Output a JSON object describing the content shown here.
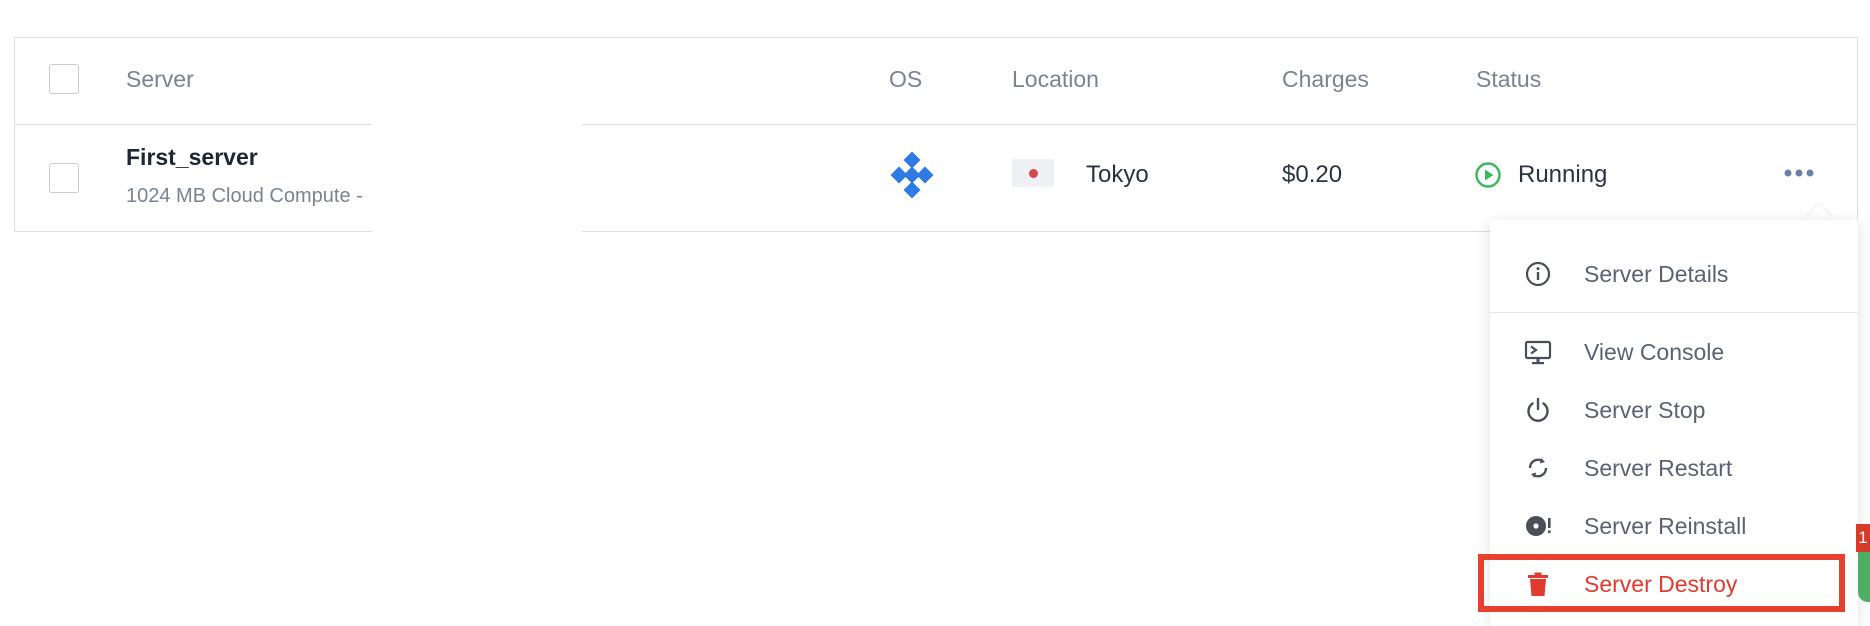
{
  "table": {
    "headers": {
      "server": "Server",
      "os": "OS",
      "location": "Location",
      "charges": "Charges",
      "status": "Status"
    },
    "rows": [
      {
        "name": "First_server",
        "plan": "1024 MB Cloud Compute -",
        "os_icon": "os-logo-icon",
        "location_flag": "japan-flag-icon",
        "location": "Tokyo",
        "charges": "$0.20",
        "status": "Running",
        "status_color": "#3cb85c"
      }
    ]
  },
  "menu": {
    "items": [
      {
        "label": "Server Details",
        "icon": "info-icon"
      },
      {
        "label": "View Console",
        "icon": "console-icon"
      },
      {
        "label": "Server Stop",
        "icon": "power-icon"
      },
      {
        "label": "Server Restart",
        "icon": "restart-icon"
      },
      {
        "label": "Server Reinstall",
        "icon": "reinstall-icon"
      },
      {
        "label": "Server Destroy",
        "icon": "trash-icon",
        "danger": true
      }
    ]
  },
  "colors": {
    "accent_blue": "#2f7be6",
    "danger_red": "#e13a2e",
    "running_green": "#3cb85c",
    "highlight": "#e8402e"
  },
  "corner_badge": "1"
}
